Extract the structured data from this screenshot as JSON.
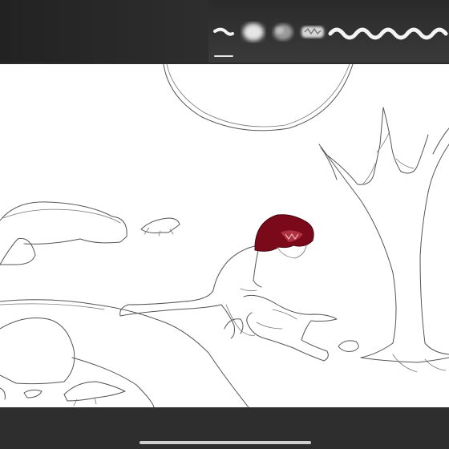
{
  "toolbar": {
    "brushes": [
      {
        "name": "stroke-brush",
        "selected": true
      },
      {
        "name": "soft-airbrush",
        "selected": false
      },
      {
        "name": "noise-brush",
        "selected": false
      },
      {
        "name": "texture-brush",
        "selected": false
      },
      {
        "name": "wave-brush",
        "selected": false
      }
    ],
    "selected_index": 0
  },
  "canvas": {
    "subject": "sketch",
    "accent_color": "#7a0a1a"
  },
  "colors": {
    "toolbar_bg": "#2b2b2b",
    "canvas_bg": "#ffffff",
    "stroke": "#555555",
    "indicator": "#e8e8e8"
  }
}
